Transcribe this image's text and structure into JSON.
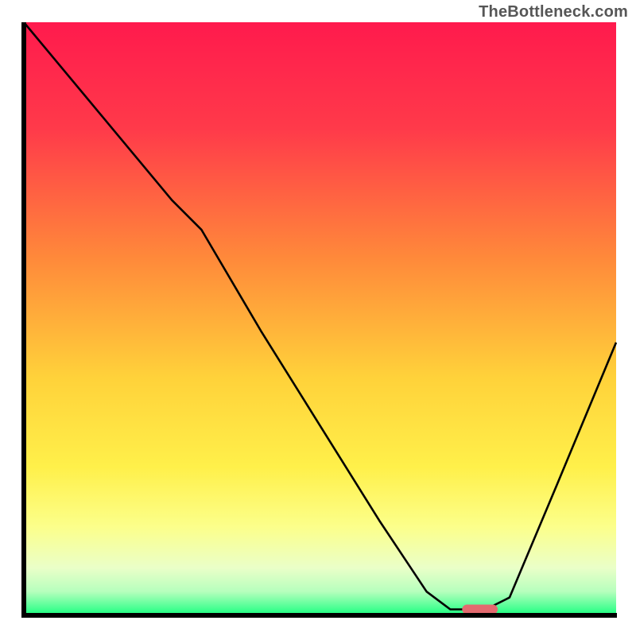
{
  "watermark": "TheBottleneck.com",
  "chart_data": {
    "type": "line",
    "title": "",
    "xlabel": "",
    "ylabel": "",
    "xlim": [
      0,
      100
    ],
    "ylim": [
      0,
      100
    ],
    "grid": false,
    "gradient_stops": [
      {
        "offset": 0,
        "color": "#ff1a4d"
      },
      {
        "offset": 18,
        "color": "#ff3a4a"
      },
      {
        "offset": 40,
        "color": "#ff8a3a"
      },
      {
        "offset": 60,
        "color": "#ffd23a"
      },
      {
        "offset": 75,
        "color": "#fff04a"
      },
      {
        "offset": 85,
        "color": "#fcff8a"
      },
      {
        "offset": 92,
        "color": "#eaffc8"
      },
      {
        "offset": 96,
        "color": "#b6ffbd"
      },
      {
        "offset": 100,
        "color": "#1aff80"
      }
    ],
    "curve": {
      "x": [
        0,
        5,
        15,
        25,
        30,
        40,
        50,
        60,
        68,
        72,
        78,
        82,
        90,
        100
      ],
      "y": [
        100,
        94,
        82,
        70,
        65,
        48,
        32,
        16,
        4,
        1,
        1,
        3,
        22,
        46
      ]
    },
    "marker": {
      "x_start": 74,
      "x_end": 80,
      "y": 1,
      "color": "#e46a6f"
    },
    "axis_color": "#000000",
    "curve_color": "#000000"
  }
}
